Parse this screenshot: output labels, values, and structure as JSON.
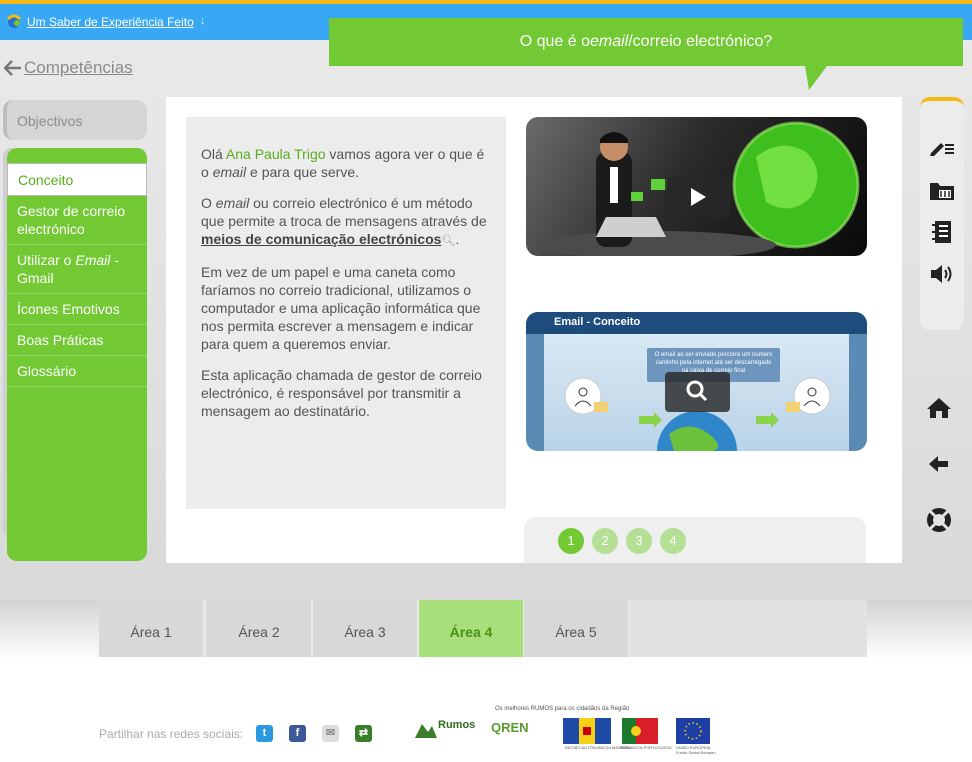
{
  "header": {
    "site_title": "Um Saber de Experiência Feito",
    "site_title_arrow": "↓"
  },
  "back_link": {
    "label": "Competências"
  },
  "bubble": {
    "text_before": "O que é o ",
    "text_em": "email",
    "text_after": "/correio electrónico?"
  },
  "objectives": {
    "label": "Objectivos"
  },
  "side_menu": {
    "items": [
      {
        "label": "Conceito"
      },
      {
        "label": "Gestor de correio electrónico"
      },
      {
        "label_before": "Utilizar o ",
        "label_em": "Email",
        "label_after": " - Gmail"
      },
      {
        "label": "Ícones Emotivos"
      },
      {
        "label": "Boas Práticas"
      },
      {
        "label": "Glossário"
      }
    ]
  },
  "text": {
    "p1_a": "Olá ",
    "p1_name": "Ana Paula Trigo",
    "p1_b": " vamos agora ver o que é o ",
    "p1_em": "email",
    "p1_c": " e para que serve.",
    "p2_a": "O ",
    "p2_em": "email",
    "p2_b": " ou correio electrónico é um método que permite a troca de mensagens através de ",
    "p2_link": "meios de comunicação electrónicos",
    "p2_c": ".",
    "p3": "Em vez de um papel e uma caneta como faríamos no correio tradicional, utilizamos o computador e uma aplicação informática que nos permita escrever a mensagem e indicar para quem a queremos enviar.",
    "p4": "Esta aplicação chamada de gestor de correio electrónico, é responsável por transmitir a mensagem ao destinatário."
  },
  "media2": {
    "title": "Email - Conceito",
    "note": "O email ao ser enviado percorre um numero caminho pela internet até ser descarregado na caixa de correio final"
  },
  "pager": {
    "pages": [
      "1",
      "2",
      "3",
      "4"
    ],
    "active": "1"
  },
  "areas": {
    "tabs": [
      "Área 1",
      "Área 2",
      "Área 3",
      "Área 4",
      "Área 5"
    ],
    "active": "Área 4"
  },
  "footer": {
    "share_label": "Partilhar nas redes sociais:",
    "partners_title": "Os melhores RUMOS para os cidadãos da Região",
    "partner_rumos": "Rumos",
    "partner_qren": "QREN",
    "cap_madeira": "REGIÃO AUTÓNOMA DA MADEIRA",
    "cap_portugal": "REPÚBLICA PORTUGUESA",
    "cap_eu": "UNIÃO EUROPEIA Fundo Social Europeu"
  },
  "colors": {
    "accent_green": "#72c933",
    "top_blue": "#38a8f4",
    "top_orange": "#f6b814"
  }
}
